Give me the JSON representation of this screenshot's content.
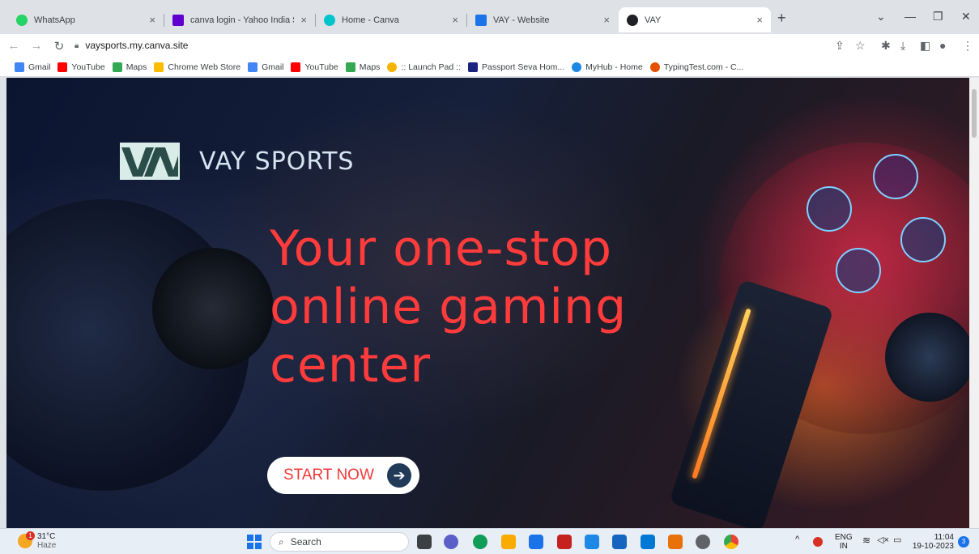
{
  "browser": {
    "tabs": [
      {
        "title": "WhatsApp",
        "icon": "whatsapp-icon",
        "color": "#25d366",
        "active": false
      },
      {
        "title": "canva login - Yahoo India Search",
        "icon": "yahoo-icon",
        "color": "#6001d2",
        "active": false
      },
      {
        "title": "Home - Canva",
        "icon": "canva-icon",
        "color": "#00c4cc",
        "active": false
      },
      {
        "title": "VAY - Website",
        "icon": "canva-site-icon",
        "color": "#1a73e8",
        "active": false
      },
      {
        "title": "VAY",
        "icon": "site-icon",
        "color": "#202124",
        "active": true
      }
    ],
    "url": "vaysports.my.canva.site",
    "bookmarks": [
      {
        "label": "Gmail",
        "icon": "google-icon",
        "color": "#4285f4"
      },
      {
        "label": "YouTube",
        "icon": "youtube-icon",
        "color": "#ff0000"
      },
      {
        "label": "Maps",
        "icon": "maps-icon",
        "color": "#34a853"
      },
      {
        "label": "Chrome Web Store",
        "icon": "webstore-icon",
        "color": "#fbbc04"
      },
      {
        "label": "Gmail",
        "icon": "google-icon",
        "color": "#4285f4"
      },
      {
        "label": "YouTube",
        "icon": "youtube-icon",
        "color": "#ff0000"
      },
      {
        "label": "Maps",
        "icon": "maps-icon",
        "color": "#34a853"
      },
      {
        "label": ":: Launch Pad ::",
        "icon": "launchpad-icon",
        "color": "#f4b400"
      },
      {
        "label": "Passport Seva Hom...",
        "icon": "passport-icon",
        "color": "#1a237e"
      },
      {
        "label": "MyHub - Home",
        "icon": "myhub-icon",
        "color": "#1e88e5"
      },
      {
        "label": "TypingTest.com - C...",
        "icon": "typingtest-icon",
        "color": "#e65100"
      }
    ]
  },
  "page": {
    "brand_name": "VAY SPORTS",
    "headline": "Your one-stop online gaming center",
    "cta_label": "START NOW",
    "accent_color": "#ff3b3b"
  },
  "taskbar": {
    "temperature": "31°C",
    "weather": "Haze",
    "search_placeholder": "Search",
    "language": "ENG",
    "region": "IN",
    "time": "11:04",
    "date": "19-10-2023",
    "notification_count": "3",
    "weather_alert": "1"
  }
}
